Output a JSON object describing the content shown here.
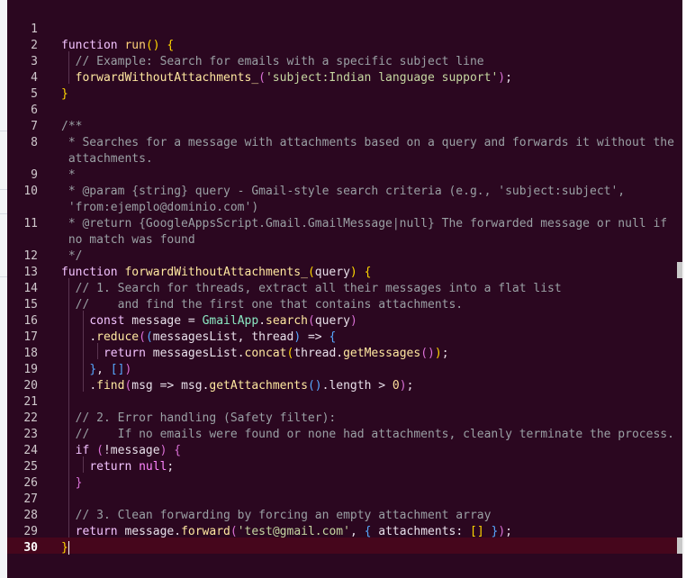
{
  "editor": {
    "current_line": "30",
    "lines": [
      {
        "n": "1",
        "tokens": []
      },
      {
        "n": "2",
        "tokens": [
          [
            "kw",
            "function "
          ],
          [
            "fn",
            "run"
          ],
          [
            "br1",
            "()"
          ],
          [
            "pn",
            " "
          ],
          [
            "br1",
            "{"
          ]
        ]
      },
      {
        "n": "3",
        "tokens": [
          [
            "cm",
            "  // Example: Search for emails with a specific subject line"
          ]
        ]
      },
      {
        "n": "4",
        "tokens": [
          [
            "txt",
            "  "
          ],
          [
            "fn2",
            "forwardWithoutAttachments_"
          ],
          [
            "br2",
            "("
          ],
          [
            "str",
            "'subject:Indian language support'"
          ],
          [
            "br2",
            ")"
          ],
          [
            "pn",
            ";"
          ]
        ]
      },
      {
        "n": "5",
        "tokens": [
          [
            "br1",
            "}"
          ]
        ]
      },
      {
        "n": "6",
        "tokens": []
      },
      {
        "n": "7",
        "tokens": [
          [
            "cm",
            "/**"
          ]
        ]
      },
      {
        "n": "8",
        "tokens": [
          [
            "cm",
            " * Searches for a message with attachments based on a query and forwards it without the"
          ]
        ]
      },
      {
        "n": "",
        "tokens": [
          [
            "cm",
            " attachments."
          ]
        ]
      },
      {
        "n": "9",
        "tokens": [
          [
            "cm",
            " *"
          ]
        ]
      },
      {
        "n": "10",
        "tokens": [
          [
            "cm",
            " * @param {string} query - Gmail-style search criteria (e.g., 'subject:subject',"
          ]
        ]
      },
      {
        "n": "",
        "tokens": [
          [
            "cm",
            " 'from:ejemplo@dominio.com')"
          ]
        ]
      },
      {
        "n": "11",
        "tokens": [
          [
            "cm",
            " * @return {GoogleAppsScript.Gmail.GmailMessage|null} The forwarded message or null if"
          ]
        ]
      },
      {
        "n": "",
        "tokens": [
          [
            "cm",
            " no match was found"
          ]
        ]
      },
      {
        "n": "12",
        "tokens": [
          [
            "cm",
            " */"
          ]
        ]
      },
      {
        "n": "13",
        "tokens": [
          [
            "kw",
            "function "
          ],
          [
            "fn2",
            "forwardWithoutAttachments_"
          ],
          [
            "br1",
            "("
          ],
          [
            "txt",
            "query"
          ],
          [
            "br1",
            ")"
          ],
          [
            "pn",
            " "
          ],
          [
            "br1",
            "{"
          ]
        ]
      },
      {
        "n": "14",
        "tokens": [
          [
            "cm",
            "  // 1. Search for threads, extract all their messages into a flat list"
          ]
        ]
      },
      {
        "n": "15",
        "tokens": [
          [
            "cm",
            "  //    and find the first one that contains attachments."
          ]
        ]
      },
      {
        "n": "16",
        "tokens": [
          [
            "txt",
            "    "
          ],
          [
            "kw",
            "const "
          ],
          [
            "txt",
            "message "
          ],
          [
            "pn",
            "= "
          ],
          [
            "cls",
            "GmailApp"
          ],
          [
            "pn",
            "."
          ],
          [
            "fn2",
            "search"
          ],
          [
            "br2",
            "("
          ],
          [
            "txt",
            "query"
          ],
          [
            "br2",
            ")"
          ]
        ]
      },
      {
        "n": "17",
        "tokens": [
          [
            "txt",
            "    "
          ],
          [
            "pn",
            "."
          ],
          [
            "fn2",
            "reduce"
          ],
          [
            "br2",
            "("
          ],
          [
            "br3",
            "("
          ],
          [
            "txt",
            "messagesList, thread"
          ],
          [
            "br3",
            ")"
          ],
          [
            "pn",
            " => "
          ],
          [
            "br3",
            "{"
          ]
        ]
      },
      {
        "n": "18",
        "tokens": [
          [
            "txt",
            "      "
          ],
          [
            "kw",
            "return "
          ],
          [
            "txt",
            "messagesList"
          ],
          [
            "pn",
            "."
          ],
          [
            "fn2",
            "concat"
          ],
          [
            "br1",
            "("
          ],
          [
            "txt",
            "thread"
          ],
          [
            "pn",
            "."
          ],
          [
            "fn2",
            "getMessages"
          ],
          [
            "br2",
            "()"
          ],
          [
            "br1",
            ")"
          ],
          [
            "pn",
            ";"
          ]
        ]
      },
      {
        "n": "19",
        "tokens": [
          [
            "txt",
            "    "
          ],
          [
            "br3",
            "}"
          ],
          [
            "pn",
            ", "
          ],
          [
            "br3",
            "[]"
          ],
          [
            "br2",
            ")"
          ]
        ]
      },
      {
        "n": "20",
        "tokens": [
          [
            "txt",
            "    "
          ],
          [
            "pn",
            "."
          ],
          [
            "fn2",
            "find"
          ],
          [
            "br2",
            "("
          ],
          [
            "txt",
            "msg "
          ],
          [
            "pn",
            "=> "
          ],
          [
            "txt",
            "msg"
          ],
          [
            "pn",
            "."
          ],
          [
            "fn2",
            "getAttachments"
          ],
          [
            "br3",
            "()"
          ],
          [
            "pn",
            "."
          ],
          [
            "txt",
            "length "
          ],
          [
            "pn",
            "> "
          ],
          [
            "num",
            "0"
          ],
          [
            "br2",
            ")"
          ],
          [
            "pn",
            ";"
          ]
        ]
      },
      {
        "n": "21",
        "tokens": []
      },
      {
        "n": "22",
        "tokens": [
          [
            "cm",
            "  // 2. Error handling (Safety filter):"
          ]
        ]
      },
      {
        "n": "23",
        "tokens": [
          [
            "cm",
            "  //    If no emails were found or none had attachments, cleanly terminate the process."
          ]
        ]
      },
      {
        "n": "24",
        "tokens": [
          [
            "txt",
            "  "
          ],
          [
            "kw",
            "if "
          ],
          [
            "br2",
            "("
          ],
          [
            "pn",
            "!"
          ],
          [
            "txt",
            "message"
          ],
          [
            "br2",
            ")"
          ],
          [
            "pn",
            " "
          ],
          [
            "br2",
            "{"
          ]
        ]
      },
      {
        "n": "25",
        "tokens": [
          [
            "txt",
            "    "
          ],
          [
            "kw",
            "return "
          ],
          [
            "kw2",
            "null"
          ],
          [
            "pn",
            ";"
          ]
        ]
      },
      {
        "n": "26",
        "tokens": [
          [
            "txt",
            "  "
          ],
          [
            "br2",
            "}"
          ]
        ]
      },
      {
        "n": "27",
        "tokens": []
      },
      {
        "n": "28",
        "tokens": [
          [
            "cm",
            "  // 3. Clean forwarding by forcing an empty attachment array"
          ]
        ]
      },
      {
        "n": "29",
        "tokens": [
          [
            "txt",
            "  "
          ],
          [
            "kw",
            "return "
          ],
          [
            "txt",
            "message"
          ],
          [
            "pn",
            "."
          ],
          [
            "fn2",
            "forward"
          ],
          [
            "br2",
            "("
          ],
          [
            "str",
            "'test@gmail.com'"
          ],
          [
            "pn",
            ", "
          ],
          [
            "br3",
            "{ "
          ],
          [
            "txt",
            "attachments"
          ],
          [
            "pn",
            ": "
          ],
          [
            "br1",
            "[]"
          ],
          [
            "br3",
            " }"
          ],
          [
            "br2",
            ")"
          ],
          [
            "pn",
            ";"
          ]
        ]
      },
      {
        "n": "30",
        "tokens": [
          [
            "br1",
            "}"
          ]
        ]
      }
    ]
  },
  "colors": {
    "background": "#2b0720",
    "current_line_highlight": "#46061c",
    "comment": "#9aa0a4",
    "keyword": "#f3c3ff",
    "string": "#c6d7a1"
  }
}
